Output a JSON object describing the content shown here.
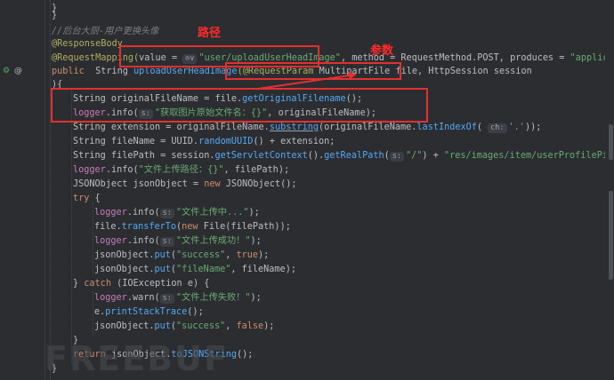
{
  "lines": {
    "l1": "}",
    "l2": "}",
    "l3_comment": "//后台大厨-用户更换头像",
    "l4_annotation": "@ResponseBody",
    "l5_annotation": "@RequestMapping(",
    "l5_value_key": "value = ",
    "l5_value_str": "\"user/uploadUserHeadImage\"",
    "l5_method": ", method = RequestMethod.POST, produces = ",
    "l5_produces": "\"application/js",
    "l6_public": "public ",
    "l6_type": " String ",
    "l6_fn": "uploadUserHeadImage",
    "l6_param_ann": "(@RequestParam",
    "l6_param": " MultipartFile file, HttpSession session",
    "l7": "){",
    "l8_decl": "String originalFileName = file.",
    "l8_call": "getOriginalFilename",
    "l8_end": "();",
    "l9_logger": "logger",
    "l9_info": ".info(",
    "l9_str": "\"获取图片原始文件名：{}\"",
    "l9_end": ", originalFileName);",
    "l10_a": "String extension = originalFileName.",
    "l10_call": "substring",
    "l10_b": "(originalFileName.",
    "l10_call2": "lastIndexOf",
    "l10_c": "( ",
    "l10_str": "'.'",
    "l10_end": "));",
    "l11_a": "String fileName = UUID.",
    "l11_call": "randomUUID",
    "l11_end": "() + extension;",
    "l12_a": "String filePath = session.",
    "l12_call": "getServletContext",
    "l12_b": "().",
    "l12_call2": "getRealPath",
    "l12_c": "(",
    "l12_str": "\"/\"",
    "l12_d": ") + ",
    "l12_str2": "\"res/images/item/userProfilePicture/\"",
    "l13_logger": "logger",
    "l13_info": ".info(",
    "l13_str": "\"文件上传路径：{}\"",
    "l13_end": ", filePath);",
    "l14_a": "JSONObject jsonObject = ",
    "l14_new": "new",
    "l14_b": " JSONObject();",
    "l15_try": "try",
    "l15_b": " {",
    "l16_logger": "logger",
    "l16_info": ".info(",
    "l16_str": "\"文件上传中...\"",
    "l16_end": ");",
    "l17_a": "file.",
    "l17_call": "transferTo",
    "l17_b": "(",
    "l17_new": "new",
    "l17_c": " File(filePath));",
    "l18_logger": "logger",
    "l18_info": ".info(",
    "l18_str": "\"文件上传成功！\"",
    "l18_end": ");",
    "l19_a": "jsonObject.",
    "l19_call": "put",
    "l19_b": "(",
    "l19_str": "\"success\"",
    "l19_c": ", ",
    "l19_true": "true",
    "l19_end": ");",
    "l20_a": "jsonObject.",
    "l20_call": "put",
    "l20_b": "(",
    "l20_str": "\"fileName\"",
    "l20_end": ", fileName);",
    "l21_a": "} ",
    "l21_catch": "catch",
    "l21_b": " (IOException e) {",
    "l22_logger": "logger",
    "l22_warn": ".warn(",
    "l22_str": "\"文件上传失败！\"",
    "l22_end": ");",
    "l23_a": "e.",
    "l23_call": "printStackTrace",
    "l23_end": "();",
    "l24_a": "jsonObject.",
    "l24_call": "put",
    "l24_b": "(",
    "l24_str": "\"success\"",
    "l24_c": ", ",
    "l24_false": "false",
    "l24_end": ");",
    "l25": "}",
    "l26_return": "return",
    "l26_a": " jsonObject.",
    "l26_call": "toJSONString",
    "l26_end": "();",
    "l27": "}"
  },
  "hints": {
    "value_hint": "⊙∨",
    "s_hint": "s:",
    "ch_hint": "ch:"
  },
  "annotations": {
    "path_label": "路径",
    "param_label": "参数"
  },
  "watermark": "FREEBUF",
  "colors": {
    "annotation_red": "#e33030",
    "background": "#2b2d30"
  },
  "gutter": {
    "run_icon": "⚙",
    "at_icon": "@"
  }
}
